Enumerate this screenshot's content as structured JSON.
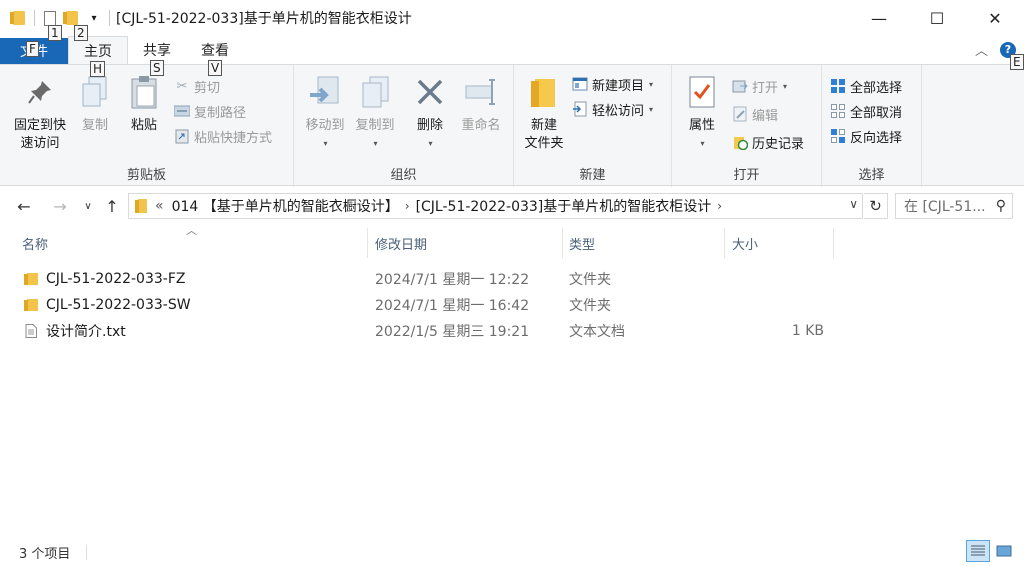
{
  "window": {
    "title": "[CJL-51-2022-033]基于单片机的智能衣柜设计",
    "minimize_glyph": "—",
    "maximize_glyph": "☐",
    "close_glyph": "✕"
  },
  "keytips": {
    "qat1": "1",
    "qat2": "2",
    "file": "F",
    "home": "H",
    "share": "S",
    "view": "V",
    "help": "E"
  },
  "tabs": {
    "file": "文件",
    "home": "主页",
    "share": "共享",
    "view": "查看"
  },
  "ribbon": {
    "clipboard": {
      "label": "剪贴板",
      "pin_line1": "固定到快",
      "pin_line2": "速访问",
      "copy": "复制",
      "paste": "粘贴",
      "cut": "剪切",
      "copy_path": "复制路径",
      "paste_shortcut": "粘贴快捷方式"
    },
    "organize": {
      "label": "组织",
      "move_to": "移动到",
      "copy_to": "复制到",
      "delete": "删除",
      "rename": "重命名"
    },
    "new": {
      "label": "新建",
      "new_folder_line1": "新建",
      "new_folder_line2": "文件夹",
      "new_item": "新建项目",
      "easy_access": "轻松访问"
    },
    "open": {
      "label": "打开",
      "properties": "属性",
      "open": "打开",
      "edit": "编辑",
      "history": "历史记录"
    },
    "select": {
      "label": "选择",
      "select_all": "全部选择",
      "select_none": "全部取消",
      "invert": "反向选择"
    }
  },
  "address": {
    "overflow": "«",
    "crumbs": [
      "014 【基于单片机的智能衣橱设计】",
      "[CJL-51-2022-033]基于单片机的智能衣柜设计"
    ],
    "search_placeholder": "在 [CJL-51..."
  },
  "columns": {
    "name": "名称",
    "modified": "修改日期",
    "type": "类型",
    "size": "大小"
  },
  "files": [
    {
      "name": "CJL-51-2022-033-FZ",
      "modified": "2024/7/1 星期一 12:22",
      "type": "文件夹",
      "size": "",
      "icon": "folder-icon"
    },
    {
      "name": "CJL-51-2022-033-SW",
      "modified": "2024/7/1 星期一 16:42",
      "type": "文件夹",
      "size": "",
      "icon": "folder-icon"
    },
    {
      "name": "设计简介.txt",
      "modified": "2022/1/5 星期三 19:21",
      "type": "文本文档",
      "size": "1 KB",
      "icon": "text-file-icon"
    }
  ],
  "status": {
    "item_count": "3 个项目"
  },
  "colors": {
    "accent": "#1868b7",
    "folder": "#f2c44b",
    "ribbon_bg": "#f5f6f7"
  }
}
